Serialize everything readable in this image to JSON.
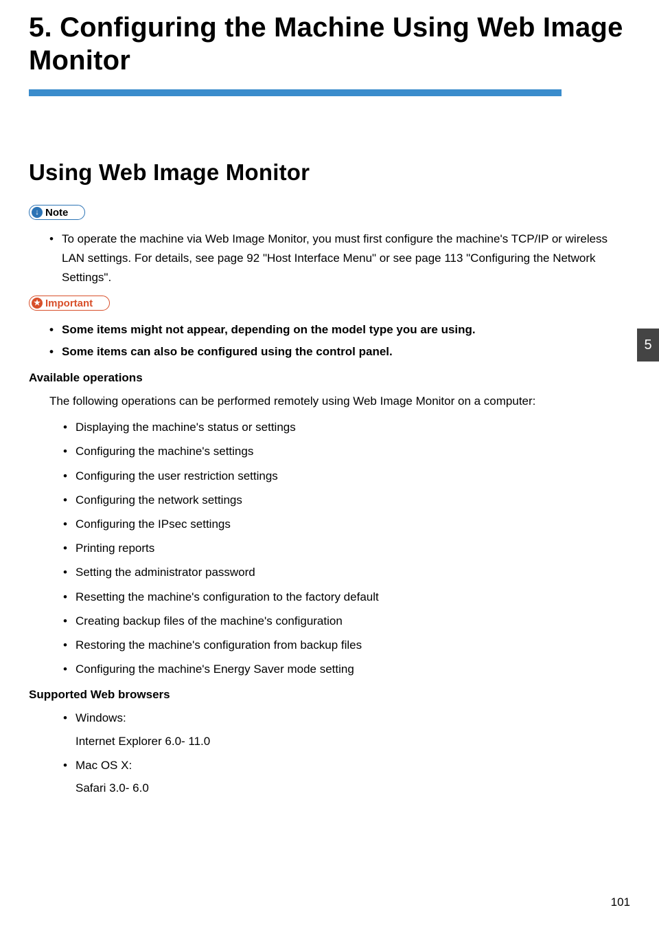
{
  "chapter": {
    "title": "5. Configuring the Machine Using Web Image Monitor"
  },
  "section": {
    "title": "Using Web Image Monitor"
  },
  "note": {
    "label": "Note",
    "items": [
      "To operate the machine via Web Image Monitor, you must first configure the machine's TCP/IP or wireless LAN settings. For details, see page 92 \"Host Interface Menu\" or see page 113 \"Configuring the Network Settings\"."
    ]
  },
  "important": {
    "label": "Important",
    "items": [
      "Some items might not appear, depending on the model type you are using.",
      "Some items can also be configured using the control panel."
    ]
  },
  "available": {
    "heading": "Available operations",
    "intro": "The following operations can be performed remotely using Web Image Monitor on a computer:",
    "items": [
      "Displaying the machine's status or settings",
      "Configuring the machine's settings",
      "Configuring the user restriction settings",
      "Configuring the network settings",
      "Configuring the IPsec settings",
      "Printing reports",
      "Setting the administrator password",
      "Resetting the machine's configuration to the factory default",
      "Creating backup files of the machine's configuration",
      "Restoring the machine's configuration from backup files",
      "Configuring the machine's Energy Saver mode setting"
    ]
  },
  "browsers": {
    "heading": "Supported Web browsers",
    "items": [
      {
        "os": "Windows:",
        "detail": "Internet Explorer 6.0- 11.0"
      },
      {
        "os": "Mac OS X:",
        "detail": "Safari 3.0- 6.0"
      }
    ]
  },
  "sidetab": "5",
  "pagenum": "101"
}
